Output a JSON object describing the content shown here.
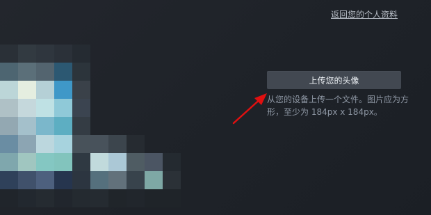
{
  "header": {
    "back_link": "返回您的个人资料"
  },
  "avatar_preview": {
    "type": "pixelated-image"
  },
  "upload": {
    "button_label": "上传您的头像",
    "help_text": "从您的设备上传一个文件。图片应为方形，至少为 184px x 184px。"
  },
  "annotation": {
    "arrow_color": "#e01010",
    "arrow_icon": "red-arrow-icon"
  }
}
